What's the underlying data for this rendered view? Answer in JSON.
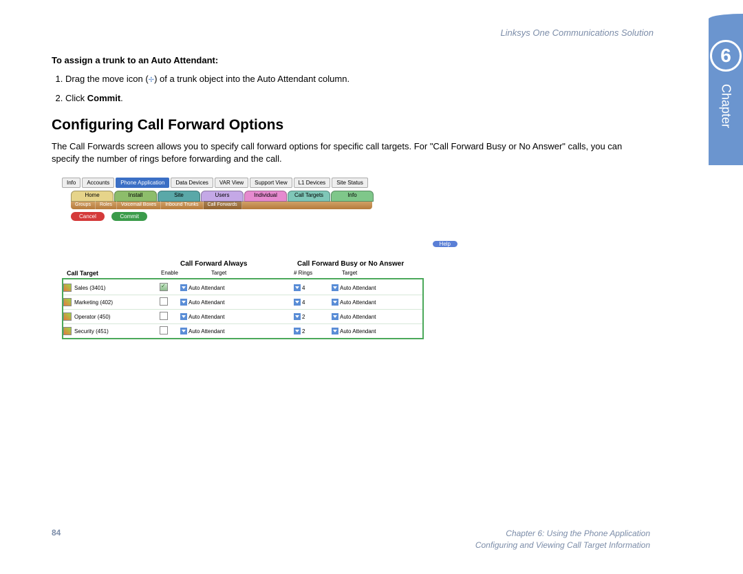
{
  "header": {
    "product": "Linksys One Communications Solution"
  },
  "chapter": {
    "number": "6",
    "label": "Chapter"
  },
  "content": {
    "sub_heading": "To assign a trunk to an Auto Attendant:",
    "step1_pre": "Drag the move icon (",
    "step1_icon": "✢",
    "step1_post": ") of a trunk object into the Auto Attendant column.",
    "step2_pre": "Click ",
    "step2_bold": "Commit",
    "step2_post": ".",
    "section_heading": "Configuring Call Forward Options",
    "section_para": "The Call Forwards screen allows you to specify call forward options for specific call targets. For \"Call Forward Busy or No Answer\" calls, you can specify the number of rings before forwarding and the call."
  },
  "screenshot": {
    "main_tabs": [
      "Info",
      "Accounts",
      "Phone Application",
      "Data Devices",
      "VAR View",
      "Support View",
      "L1 Devices",
      "Site Status"
    ],
    "active_main": 2,
    "nav1": [
      {
        "label": "Home",
        "bg": "#e6d48a"
      },
      {
        "label": "Install",
        "bg": "#8dbd6b"
      },
      {
        "label": "Site",
        "bg": "#5aa8a8"
      },
      {
        "label": "Users",
        "bg": "#c4a8e6"
      },
      {
        "label": "Individual",
        "bg": "#e68acf"
      },
      {
        "label": "Call Targets",
        "bg": "#7fc7b8"
      },
      {
        "label": "Info",
        "bg": "#7fc78a"
      }
    ],
    "nav2": [
      "Groups",
      "Roles",
      "Voicemail Boxes",
      "Inbound Trunks",
      "Call Forwards"
    ],
    "cancel_btn": "Cancel",
    "commit_btn": "Commit",
    "help_btn": "Help",
    "col_always": "Call Forward Always",
    "col_busy": "Call Forward Busy or No Answer",
    "col_target": "Call Target",
    "col_enable": "Enable",
    "col_t1": "Target",
    "col_rings": "# Rings",
    "col_t2": "Target",
    "rows": [
      {
        "name": "Sales (3401)",
        "enabled": true,
        "t1": "Auto Attendant",
        "rings": "4",
        "t2": "Auto Attendant"
      },
      {
        "name": "Marketing (402)",
        "enabled": false,
        "t1": "Auto Attendant",
        "rings": "4",
        "t2": "Auto Attendant"
      },
      {
        "name": "Operator (450)",
        "enabled": false,
        "t1": "Auto Attendant",
        "rings": "2",
        "t2": "Auto Attendant"
      },
      {
        "name": "Security (451)",
        "enabled": false,
        "t1": "Auto Attendant",
        "rings": "2",
        "t2": "Auto Attendant"
      }
    ]
  },
  "footer": {
    "page": "84",
    "line1": "Chapter 6: Using the Phone Application",
    "line2": "Configuring and Viewing Call Target Information"
  }
}
